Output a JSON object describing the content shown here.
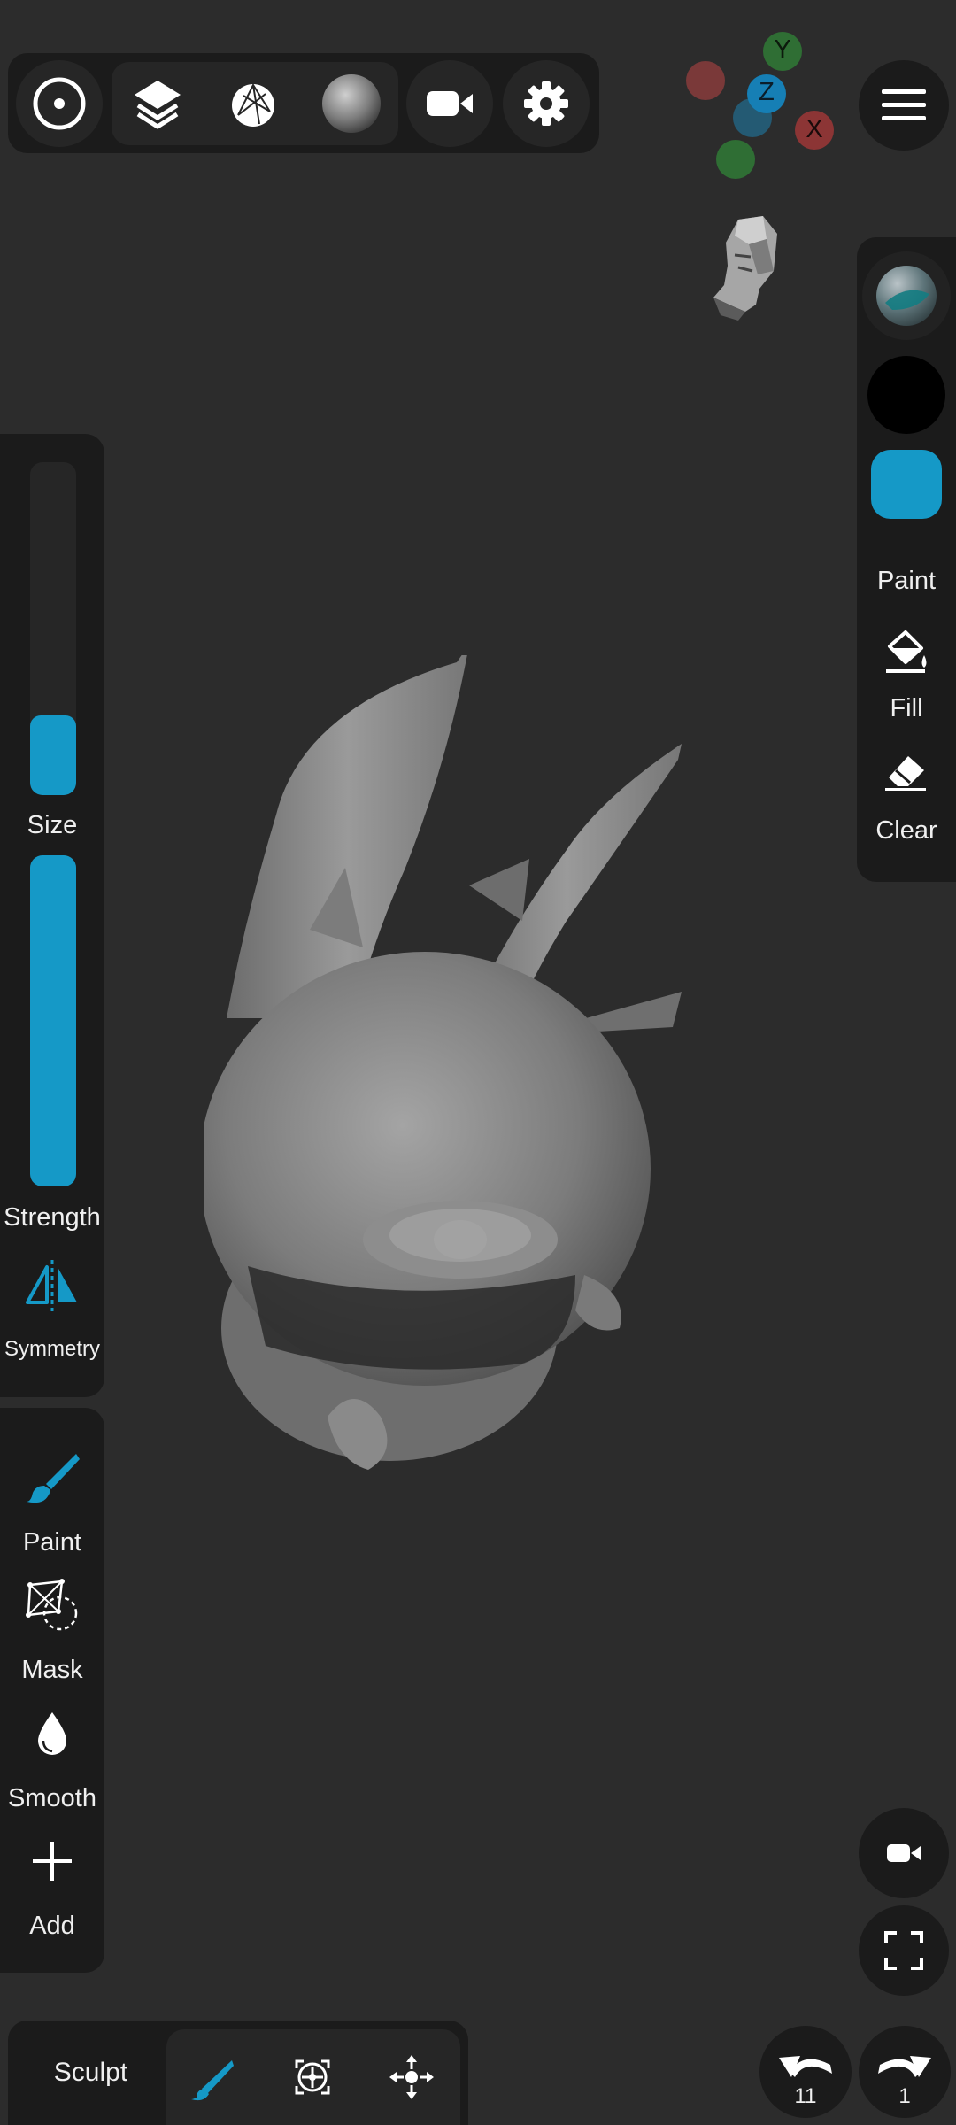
{
  "toolbar": {
    "items": [
      {
        "icon": "target-icon"
      },
      {
        "icon": "layers-icon"
      },
      {
        "icon": "topology-icon"
      },
      {
        "icon": "material-sphere-icon"
      },
      {
        "icon": "camera-icon"
      },
      {
        "icon": "gear-icon"
      }
    ]
  },
  "gizmo": {
    "y_label": "Y",
    "z_label": "Z",
    "x_label": "X"
  },
  "menu": {
    "icon": "hamburger-icon"
  },
  "right_panel": {
    "material_icon": "matcap-sphere-icon",
    "color_black": "#000000",
    "color_accent": "#1599c7",
    "paint_label": "Paint",
    "fill_label": "Fill",
    "clear_label": "Clear"
  },
  "left_panel": {
    "size_label": "Size",
    "size_level": 0.24,
    "strength_label": "Strength",
    "strength_level": 1.0,
    "symmetry_label": "Symmetry"
  },
  "tools": {
    "paint_label": "Paint",
    "mask_label": "Mask",
    "smooth_label": "Smooth",
    "add_label": "Add"
  },
  "bottom_bar": {
    "mode_label": "Sculpt",
    "undo_count": "11",
    "redo_count": "1"
  },
  "colors": {
    "accent": "#1599c7",
    "panel": "#1b1b1b",
    "background": "#2c2c2c"
  }
}
